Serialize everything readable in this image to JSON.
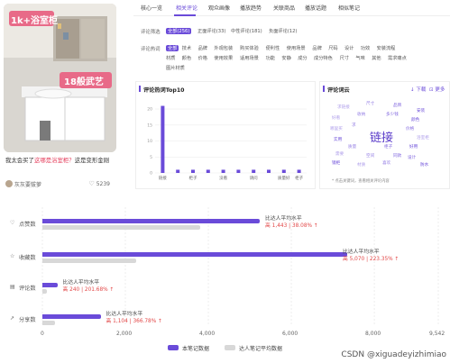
{
  "card": {
    "thumb_text_1": "1k+浴室柜",
    "thumb_text_2": "18般武艺",
    "caption_pre": "我太会买了",
    "caption_hl": "这哪是浴室柜？",
    "caption_post": "这是变形金刚",
    "author": "灰灰要拔萝",
    "likes": "5239"
  },
  "tabs": [
    "核心一览",
    "相关评论",
    "观众画像",
    "播放趋势",
    "关联商品",
    "播放话题",
    "相似笔记"
  ],
  "active_tab": 1,
  "filter": {
    "row1_label": "评论筛选",
    "row1": [
      "全部(256)",
      "正面评论(33)",
      "中性评论(181)",
      "负面评论(12)"
    ],
    "row2_label": "评论热词",
    "row2_line1": [
      "全部",
      "技术",
      "品牌",
      "外观包装",
      "购买体验",
      "便利性",
      "使用场景",
      "品牌",
      "尺码",
      "设计",
      "功效",
      "安装流程"
    ],
    "row2_line2": [
      "材质",
      "颜色",
      "价格",
      "使用效果",
      "适用场景",
      "功能",
      "安静",
      "成分",
      "成分特色",
      "尺寸",
      "气味",
      "其他",
      "需求痛点"
    ],
    "row2_line3": [
      "图片材质"
    ]
  },
  "hotwords": {
    "title": "评论热词Top10",
    "yticks": [
      "20",
      "15",
      "10",
      "5",
      "0"
    ]
  },
  "wordcloud": {
    "title": "评论词云",
    "link1": "↓ 下载",
    "link2": "⊡ 更多",
    "center_word": "链接",
    "words": [
      "求链接",
      "尺寸",
      "品牌",
      "安装",
      "好看",
      "收纳",
      "多少钱",
      "颜色",
      "哪里买",
      "求",
      "价格",
      "实用",
      "浴室柜",
      "质量",
      "柜子",
      "好用",
      "需要",
      "空间",
      "同款",
      "镜柜",
      "材质",
      "喜欢",
      "设计",
      "防水"
    ],
    "note": "* 点击关键词，查看相关评论内容"
  },
  "chart_data": [
    {
      "type": "bar",
      "title": "评论热词Top10",
      "categories": [
        "链接",
        "",
        "柜子",
        "",
        "没看",
        "",
        "请问",
        "",
        "质量好",
        "柜子"
      ],
      "values": [
        21,
        1,
        1,
        1,
        1,
        1,
        1,
        1,
        1,
        1
      ],
      "ylim": [
        0,
        22
      ],
      "grid": true
    },
    {
      "type": "bar",
      "orientation": "horizontal",
      "categories": [
        "点赞数",
        "收藏数",
        "评论数",
        "分享数"
      ],
      "series": [
        {
          "name": "本笔记数据",
          "values": [
            5239,
            7341,
            359,
            1403
          ]
        },
        {
          "name": "达人笔记平均数据",
          "values": [
            3796,
            2271,
            119,
            299
          ]
        }
      ],
      "xticks": [
        "0",
        "2,000",
        "4,000",
        "6,000",
        "8,000",
        "9,542"
      ],
      "xlim": [
        0,
        9542
      ],
      "legend": "bottom",
      "annotations": [
        {
          "label": "比达人平均水平",
          "delta": "高 1,443",
          "pct": "38.08%"
        },
        {
          "label": "比达人平均水平",
          "delta": "高 5,070",
          "pct": "223.35%"
        },
        {
          "label": "比达人平均水平",
          "delta": "高 240",
          "pct": "201.68%"
        },
        {
          "label": "比达人平均水平",
          "delta": "高 1,104",
          "pct": "366.78%"
        }
      ],
      "colors": {
        "primary": "#6a4bd9",
        "secondary": "#d8d8d8"
      }
    }
  ],
  "watermark": "CSDN @xiguadeyizhimiao"
}
